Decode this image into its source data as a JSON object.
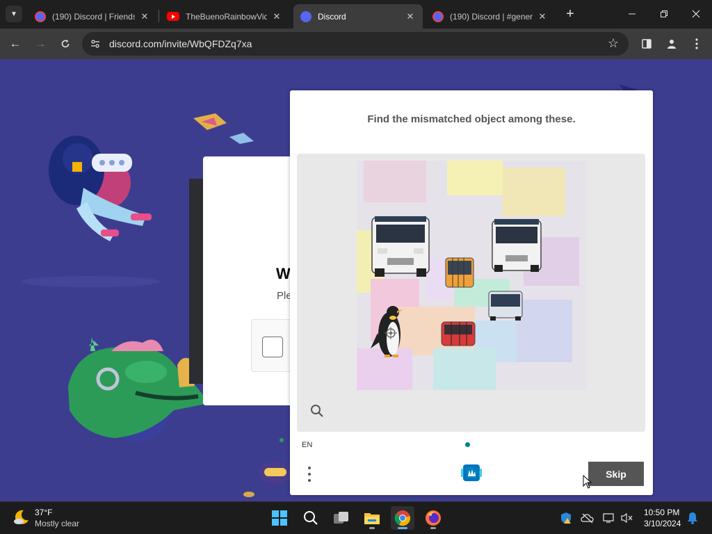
{
  "browser": {
    "tabs": [
      {
        "title": "(190) Discord | Friends",
        "favicon": "discord-notification-icon",
        "badge": "190",
        "active": false
      },
      {
        "title": "TheBuenoRainbowVid",
        "favicon": "youtube-icon",
        "active": false
      },
      {
        "title": "Discord",
        "favicon": "discord-icon",
        "active": true
      },
      {
        "title": "(190) Discord | #gener",
        "favicon": "discord-notification-icon",
        "badge": "190",
        "active": false
      }
    ],
    "url": "discord.com/invite/WbQFDZq7xa",
    "colors": {
      "tabbar": "#1f1f1f",
      "toolbar": "#3c3c3c",
      "omnibox": "#282828"
    }
  },
  "discord_modal": {
    "heading_partial": "W",
    "subtext_partial": "Ple"
  },
  "captcha": {
    "prompt": "Find the mismatched object among these.",
    "language": "EN",
    "skip_label": "Skip",
    "image_objects": [
      "bus",
      "bus",
      "bus",
      "bus",
      "bus",
      "bus",
      "penguin"
    ],
    "colors": {
      "skip": "#555555",
      "dot": "#00838f",
      "task_bg": "#e8e8e8"
    }
  },
  "taskbar": {
    "weather": {
      "temp": "37°F",
      "desc": "Mostly clear"
    },
    "apps": [
      "windows-start-icon",
      "search-icon",
      "task-view-icon",
      "file-explorer-icon",
      "chrome-icon",
      "firefox-icon"
    ],
    "clock": {
      "time": "10:50 PM",
      "date": "3/10/2024"
    }
  }
}
